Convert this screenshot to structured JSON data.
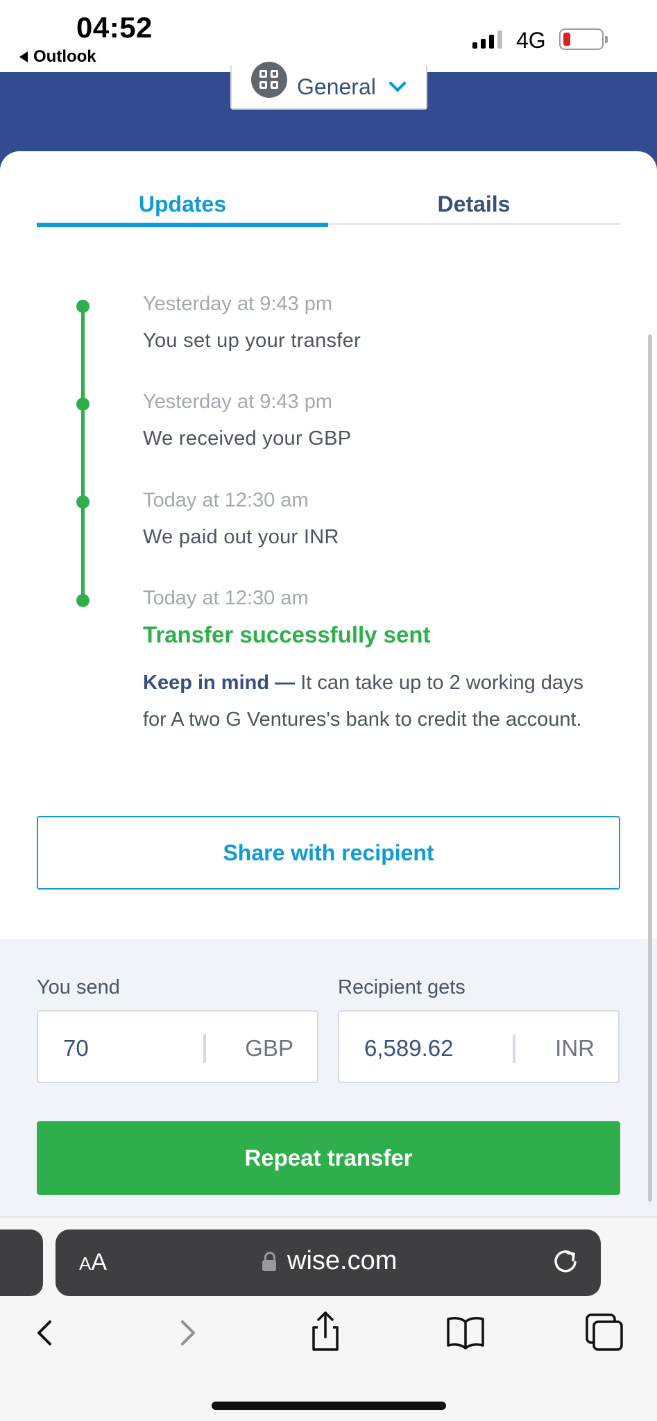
{
  "status_bar": {
    "time": "04:52",
    "back_app": "Outlook",
    "network": "4G"
  },
  "header": {
    "category": "General",
    "icon": "grid-icon"
  },
  "tabs": [
    {
      "label": "Updates",
      "active": true
    },
    {
      "label": "Details",
      "active": false
    }
  ],
  "timeline": [
    {
      "time": "Yesterday at 9:43 pm",
      "text": "You set up your transfer"
    },
    {
      "time": "Yesterday at 9:43 pm",
      "text": "We received your GBP"
    },
    {
      "time": "Today at 12:30 am",
      "text": "We paid out your INR"
    },
    {
      "time": "Today at 12:30 am",
      "text": "Transfer successfully sent"
    }
  ],
  "note": {
    "emphasis": "Keep in mind —",
    "body": " It can take up to 2 working days for A two G Ventures's bank to credit the account."
  },
  "share_button": "Share with recipient",
  "converter": {
    "send_label": "You send",
    "send_amount": "70",
    "send_currency": "GBP",
    "receive_label": "Recipient gets",
    "receive_amount": "6,589.62",
    "receive_currency": "INR"
  },
  "repeat_button": "Repeat transfer",
  "browser": {
    "text_size": "AA",
    "url": "wise.com"
  },
  "colors": {
    "brand_blue": "#324c8f",
    "accent": "#0f9bd7",
    "success": "#2eaf4b"
  }
}
